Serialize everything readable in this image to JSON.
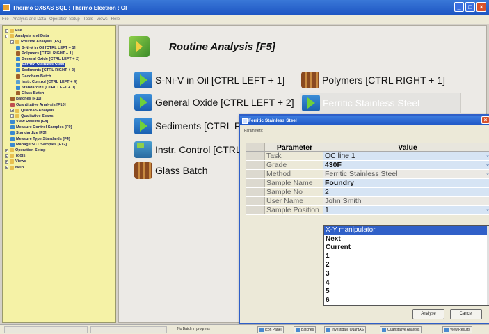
{
  "window": {
    "title": "Thermo OXSAS    SQL : Thermo Electron : OI"
  },
  "menu": [
    "File",
    "Analysis and Data",
    "Operation Setup",
    "Tools",
    "Views",
    "Help"
  ],
  "tree": [
    {
      "label": "File",
      "level": 0,
      "icon": "folder-icon",
      "exp": "+"
    },
    {
      "label": "Analysis and Data",
      "level": 0,
      "icon": "folder-icon",
      "exp": "−"
    },
    {
      "label": "Routine Analysis [F5]",
      "level": 1,
      "icon": "folder-icon",
      "exp": "−"
    },
    {
      "label": "S-Ni-V in Oil [CTRL LEFT + 1]",
      "level": 2,
      "icon": "play-icon"
    },
    {
      "label": "Polymers [CTRL RIGHT + 1]",
      "level": 2,
      "icon": "brown-icon"
    },
    {
      "label": "General Oxide [CTRL LEFT + 2]",
      "level": 2,
      "icon": "play-icon"
    },
    {
      "label": "Ferritic Stainless Steel",
      "level": 2,
      "icon": "play-icon",
      "selected": true
    },
    {
      "label": "Sediments [CTRL RIGHT + 2]",
      "level": 2,
      "icon": "play-icon"
    },
    {
      "label": "Geochem Batch",
      "level": 2,
      "icon": "brown-icon"
    },
    {
      "label": "Instr. Control [CTRL LEFT + 4]",
      "level": 2,
      "icon": "instr-icon"
    },
    {
      "label": "Standardize [CTRL LEFT + 0]",
      "level": 2,
      "icon": "play-icon"
    },
    {
      "label": "Glass Batch",
      "level": 2,
      "icon": "brown-icon"
    },
    {
      "label": "Batches [F11]",
      "level": 1,
      "icon": "brown-icon"
    },
    {
      "label": "Quantitative Analysis [F10]",
      "level": 1,
      "icon": "chart-icon"
    },
    {
      "label": "QuantAS Analysis",
      "level": 1,
      "icon": "folder-icon",
      "exp": "+"
    },
    {
      "label": "Qualitative Scans",
      "level": 1,
      "icon": "folder-icon",
      "exp": "+"
    },
    {
      "label": "View Results [F8]",
      "level": 1,
      "icon": "play-icon"
    },
    {
      "label": "Measure Control Samples [F9]",
      "level": 1,
      "icon": "play-icon"
    },
    {
      "label": "Standardize [F3]",
      "level": 1,
      "icon": "play-icon"
    },
    {
      "label": "Measure Type Standards [F4]",
      "level": 1,
      "icon": "play-icon"
    },
    {
      "label": "Manage SCT Samples [F12]",
      "level": 1,
      "icon": "play-icon"
    },
    {
      "label": "Operation Setup",
      "level": 0,
      "icon": "folder-icon",
      "exp": "+"
    },
    {
      "label": "Tools",
      "level": 0,
      "icon": "folder-icon",
      "exp": "+"
    },
    {
      "label": "Views",
      "level": 0,
      "icon": "folder-icon",
      "exp": "+"
    },
    {
      "label": "Help",
      "level": 0,
      "icon": "folder-icon",
      "exp": "+"
    }
  ],
  "main": {
    "title": "Routine Analysis [F5]",
    "items": [
      {
        "label": "S-Ni-V in Oil [CTRL LEFT + 1]",
        "icon": "play"
      },
      {
        "label": "Polymers [CTRL RIGHT + 1]",
        "icon": "brown"
      },
      {
        "label": "General Oxide [CTRL LEFT + 2]",
        "icon": "play"
      },
      {
        "label": "Ferritic Stainless Steel",
        "icon": "play"
      },
      {
        "label": "Sediments [CTRL RIGHT + 2]",
        "icon": "play"
      },
      {
        "label": "Instr. Control [CTRL LEFT + 4]",
        "icon": "instr"
      },
      {
        "label": "Glass Batch",
        "icon": "brown"
      }
    ]
  },
  "dialog": {
    "title": "Ferritic Stainless Steel",
    "params_label": "Parameters:",
    "col_param": "Parameter",
    "col_value": "Value",
    "rows": [
      {
        "param": "Task",
        "value": "QC line 1",
        "dropdown": true,
        "style": "blue"
      },
      {
        "param": "Grade",
        "value": "430F",
        "dropdown": true,
        "style": "blue bold"
      },
      {
        "param": "Method",
        "value": "Ferritic Stainless Steel",
        "dropdown": true,
        "style": "gray"
      },
      {
        "param": "Sample Name",
        "value": "Foundry",
        "dropdown": false,
        "style": "blue bold"
      },
      {
        "param": "Sample No",
        "value": "2",
        "dropdown": false,
        "style": "blue"
      },
      {
        "param": "User Name",
        "value": "John Smith",
        "dropdown": false,
        "style": "gray"
      },
      {
        "param": "Sample Position",
        "value": "1",
        "dropdown": true,
        "style": "blue"
      }
    ],
    "options": [
      "X-Y manipulator",
      "Next",
      "Current",
      "1",
      "2",
      "3",
      "4",
      "5",
      "6"
    ],
    "analyse_label": "Analyse",
    "cancel_label": "Cancel"
  },
  "status": {
    "message": "No Batch in progress",
    "tabs": [
      "Icon Panel",
      "Batches",
      "Investigate QuantAS",
      "Quantitative Analysis",
      "View Results"
    ]
  }
}
